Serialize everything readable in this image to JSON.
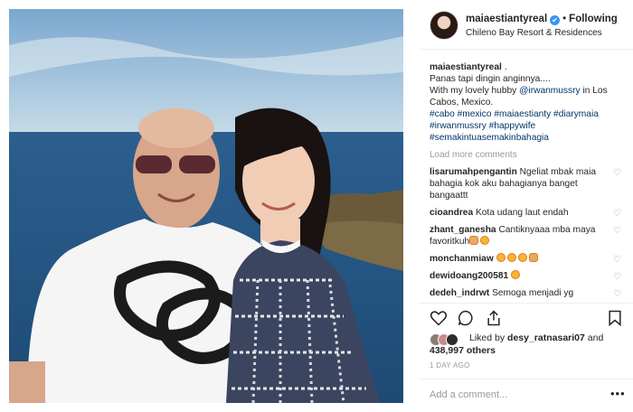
{
  "post": {
    "username": "maiaestiantyreal",
    "verified_mark": "✔",
    "follow_label": "Following",
    "location": "Chileno Bay Resort & Residences",
    "caption_user": "maiaestiantyreal",
    "caption_suffix": " .",
    "caption_line1": "Panas tapi dingin anginnya....",
    "caption_line2_prefix": "With my lovely hubby ",
    "caption_mention": "@irwanmussry",
    "caption_line2_suffix": " in Los Cabos, Mexico.",
    "hashtags": "#cabo #mexico #maiaestianty #diarymaia #irwanmussry #happywife #semakintuasemakinbahagia",
    "load_more": "Load more comments"
  },
  "comments": [
    {
      "user": "lisarumahpengantin",
      "text": " Ngeliat mbak maia bahagia kok aku bahagianya banget bangaattt",
      "emojis": []
    },
    {
      "user": "cioandrea",
      "text": " Kota udang laut endah",
      "emojis": []
    },
    {
      "user": "zhant_ganesha",
      "text": " Cantiknyaaa mba maya favoritkuh",
      "emojis": [
        "thumbs-up-emoji",
        "heart-eyes-emoji"
      ]
    },
    {
      "user": "monchanmiaw",
      "text": " ",
      "emojis": [
        "heart-eyes-emoji",
        "heart-eyes-emoji",
        "heart-eyes-emoji",
        "clap-emoji"
      ]
    },
    {
      "user": "dewidoang200581",
      "text": " ",
      "emojis": [
        "smile-emoji"
      ]
    },
    {
      "user": "dedeh_indrwt",
      "text": " Semoga menjadi yg",
      "emojis": []
    }
  ],
  "likes": {
    "prefix": "Liked by ",
    "user": "desy_ratnasari07",
    "suffix": " and",
    "count": "438,997 others"
  },
  "timeago": "1 DAY AGO",
  "add_comment_placeholder": "Add a comment...",
  "more_label": "•••",
  "colors": {
    "link": "#003569",
    "muted": "#999999",
    "verified": "#3897f0"
  }
}
